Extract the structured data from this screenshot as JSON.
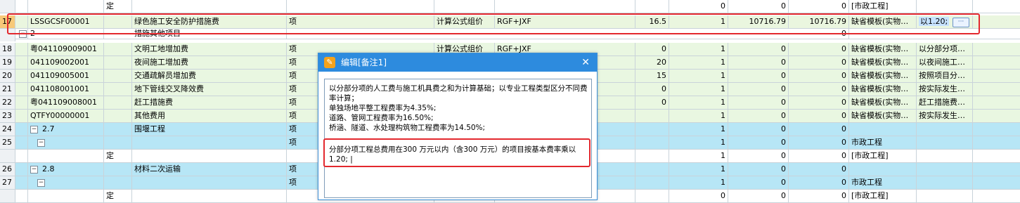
{
  "rows": [
    {
      "num": "",
      "code": "",
      "b": "定",
      "name": "",
      "unit": "",
      "method": "",
      "formula": "",
      "rate": "",
      "qty": "0",
      "price": "0",
      "total": "0",
      "note1": "[市政工程]",
      "note2": ""
    },
    {
      "num": "17",
      "code": "LSSGCSF00001",
      "b": "",
      "name": "绿色施工安全防护措施费",
      "unit": "项",
      "method": "计算公式组价",
      "formula": "RGF+JXF",
      "rate": "16.5",
      "qty": "1",
      "price": "10716.79",
      "total": "10716.79",
      "note1": "缺省模板(实物…",
      "note2": "以1.20;"
    },
    {
      "num": "",
      "code": "2",
      "b": "",
      "name": "措施其他项目",
      "unit": "",
      "method": "",
      "formula": "",
      "rate": "",
      "qty": "",
      "price": "",
      "total": "0",
      "note1": "",
      "note2": ""
    },
    {
      "num": "18",
      "code": "粤041109009001",
      "b": "",
      "name": "文明工地增加费",
      "unit": "项",
      "method": "计算公式组价",
      "formula": "RGF+JXF",
      "rate": "0",
      "qty": "1",
      "price": "0",
      "total": "0",
      "note1": "缺省模板(实物…",
      "note2": "以分部分项…"
    },
    {
      "num": "19",
      "code": "041109002001",
      "b": "",
      "name": "夜间施工增加费",
      "unit": "项",
      "method": "",
      "formula": "",
      "rate": "20",
      "qty": "1",
      "price": "0",
      "total": "0",
      "note1": "缺省模板(实物…",
      "note2": "以夜间施工…"
    },
    {
      "num": "20",
      "code": "041109005001",
      "b": "",
      "name": "交通疏解员增加费",
      "unit": "项",
      "method": "",
      "formula": "",
      "rate": "15",
      "qty": "1",
      "price": "0",
      "total": "0",
      "note1": "缺省模板(实物…",
      "note2": "按照项目分…"
    },
    {
      "num": "21",
      "code": "041108001001",
      "b": "",
      "name": "地下管线交叉降效费",
      "unit": "项",
      "method": "",
      "formula": "",
      "rate": "0",
      "qty": "1",
      "price": "0",
      "total": "0",
      "note1": "缺省模板(实物…",
      "note2": "按实际发生…"
    },
    {
      "num": "22",
      "code": "粤041109008001",
      "b": "",
      "name": "赶工措施费",
      "unit": "项",
      "method": "",
      "formula": "",
      "rate": "0",
      "qty": "1",
      "price": "0",
      "total": "0",
      "note1": "缺省模板(实物…",
      "note2": "赶工措施费…"
    },
    {
      "num": "23",
      "code": "QTFY00000001",
      "b": "",
      "name": "其他费用",
      "unit": "项",
      "method": "",
      "formula": "",
      "rate": "",
      "qty": "1",
      "price": "0",
      "total": "0",
      "note1": "缺省模板(实物…",
      "note2": "按实际发生…"
    },
    {
      "num": "24",
      "code": "2.7",
      "b": "",
      "name": "围堰工程",
      "unit": "项",
      "method": "",
      "formula": "",
      "rate": "",
      "qty": "1",
      "price": "0",
      "total": "0",
      "note1": "",
      "note2": ""
    },
    {
      "num": "25",
      "code": "",
      "b": "",
      "name": "",
      "unit": "项",
      "method": "",
      "formula": "",
      "rate": "",
      "qty": "1",
      "price": "0",
      "total": "0",
      "note1": "市政工程",
      "note2": ""
    },
    {
      "num": "",
      "code": "",
      "b": "定",
      "name": "",
      "unit": "",
      "method": "",
      "formula": "",
      "rate": "",
      "qty": "1",
      "price": "0",
      "total": "0",
      "note1": "[市政工程]",
      "note2": ""
    },
    {
      "num": "26",
      "code": "2.8",
      "b": "",
      "name": "材料二次运输",
      "unit": "项",
      "method": "",
      "formula": "",
      "rate": "",
      "qty": "1",
      "price": "0",
      "total": "0",
      "note1": "",
      "note2": ""
    },
    {
      "num": "27",
      "code": "",
      "b": "",
      "name": "",
      "unit": "项",
      "method": "",
      "formula": "",
      "rate": "",
      "qty": "1",
      "price": "0",
      "total": "0",
      "note1": "市政工程",
      "note2": ""
    },
    {
      "num": "",
      "code": "",
      "b": "定",
      "name": "",
      "unit": "",
      "method": "",
      "formula": "",
      "rate": "",
      "qty": "0",
      "price": "0",
      "total": "0",
      "note1": "[市政工程]",
      "note2": ""
    }
  ],
  "ellipsis_label": "···",
  "dialog": {
    "title": "编辑[备注1]",
    "close": "✕",
    "text1": "以分部分项的人工费与施工机具费之和为计算基础；以专业工程类型区分不同费率计算；\n单独场地平整工程费率为4.35%;\n道路、管网工程费率为16.50%;\n桥涵、隧道、水处理构筑物工程费率为14.50%;",
    "text2": "分部分项工程总费用在300 万元以内（含300 万元）的项目按基本费率乘以1.20; |"
  },
  "colors": {
    "highlight_box": "#e3282e",
    "title_bar": "#2d8bde"
  }
}
